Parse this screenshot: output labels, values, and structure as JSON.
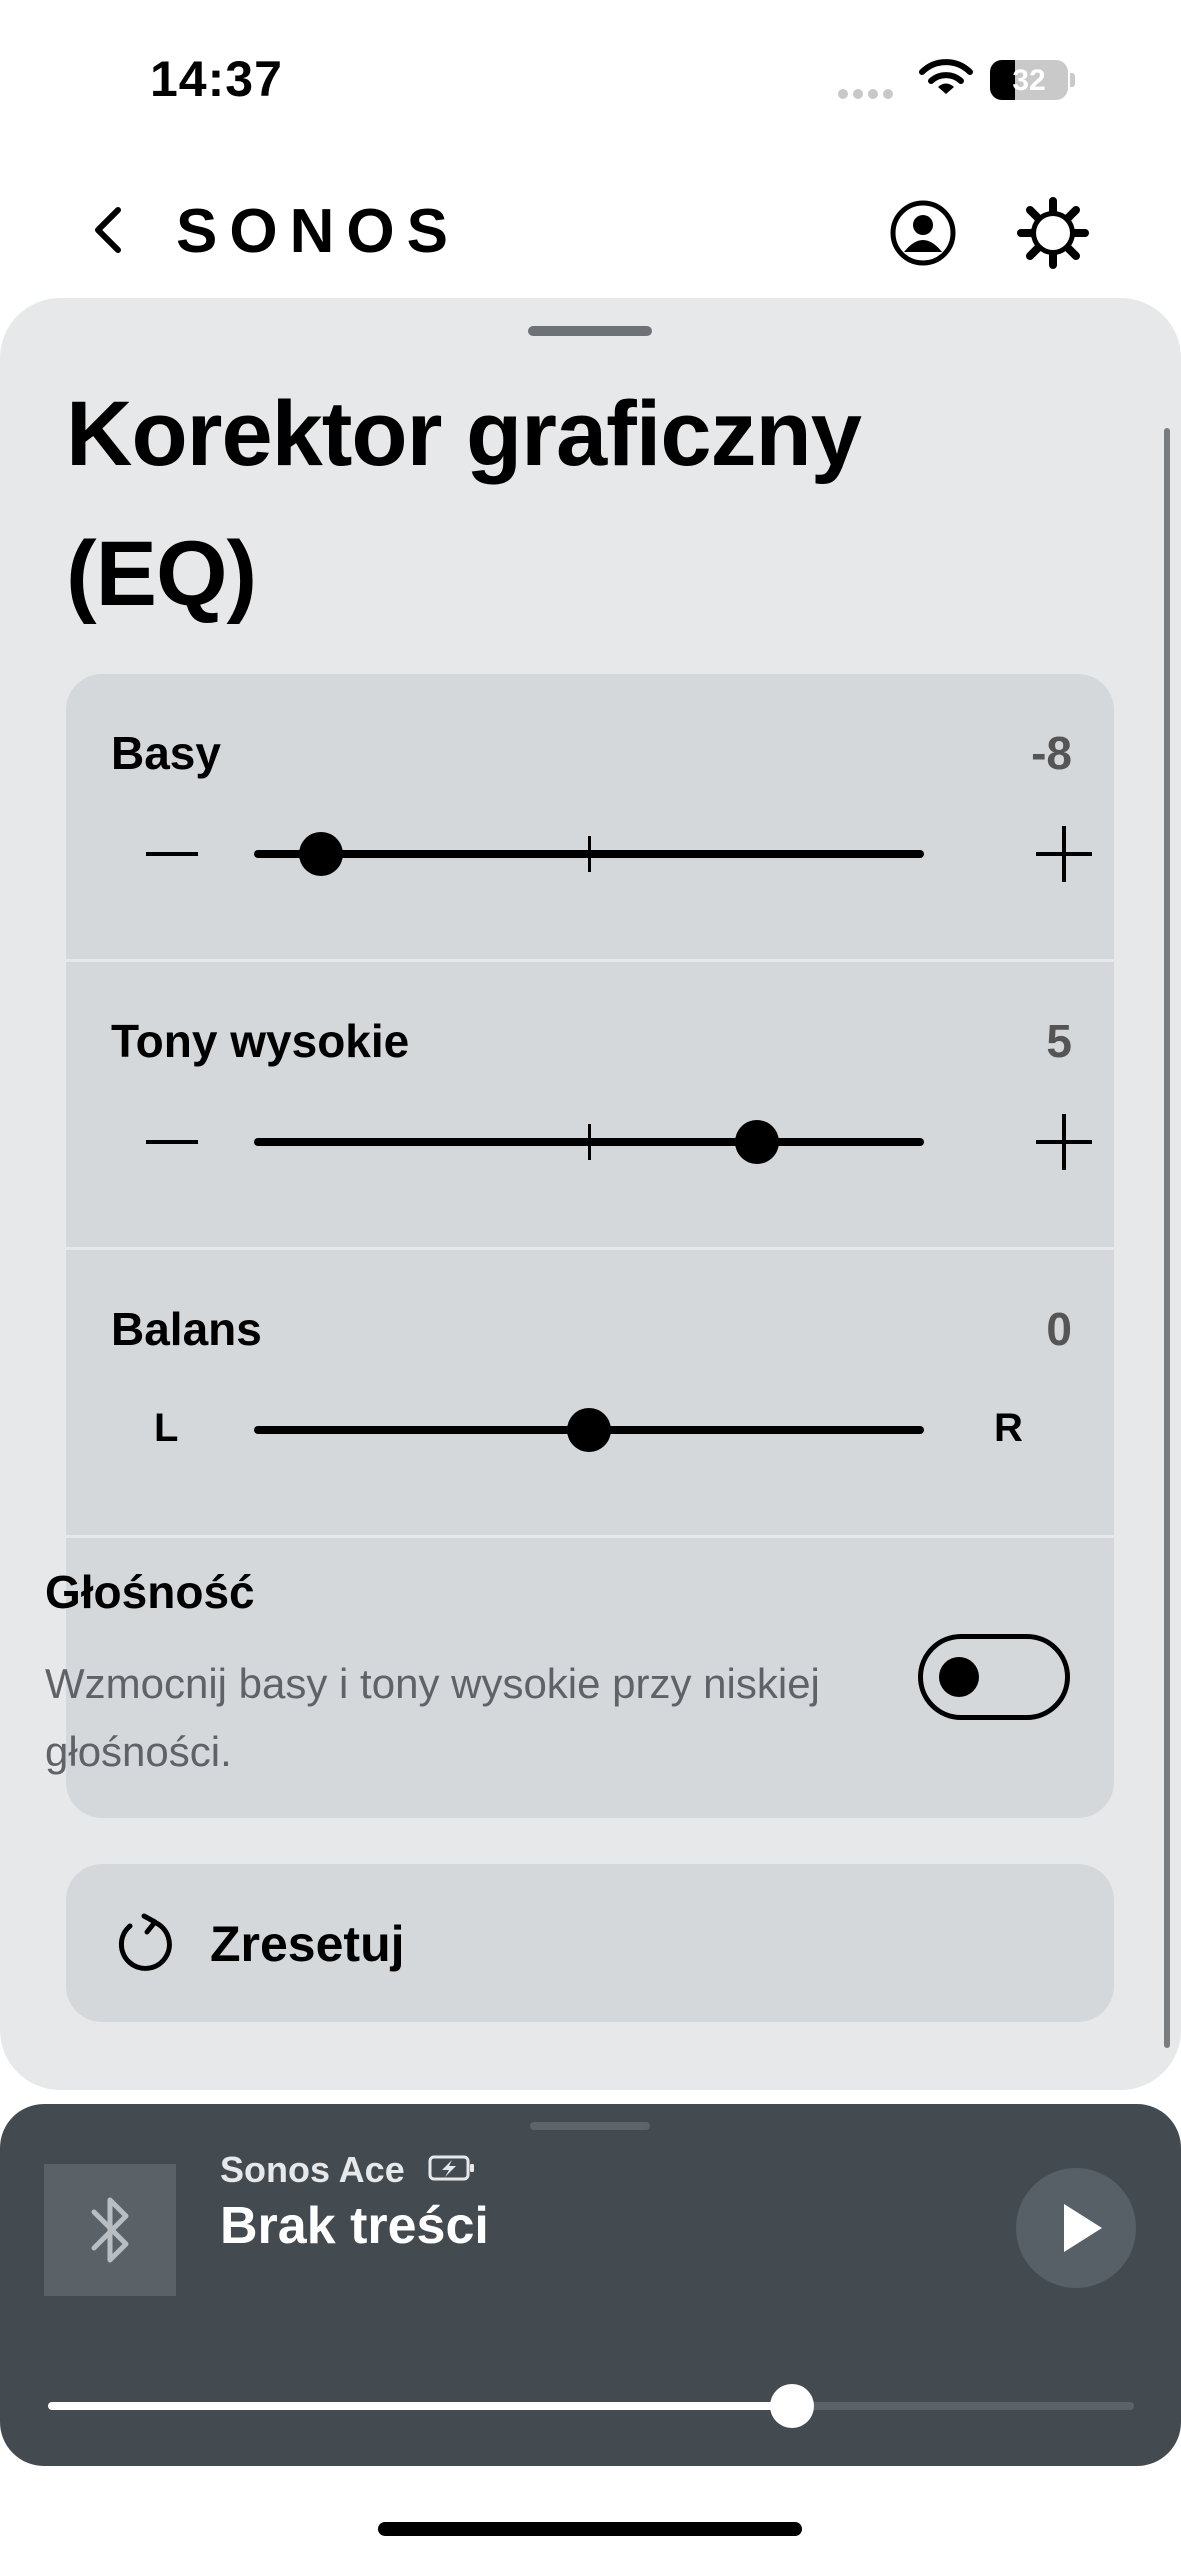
{
  "status_bar": {
    "time": "14:37",
    "battery_percent": "32",
    "battery_level": 0.32
  },
  "nav": {
    "logo": "SONOS",
    "back_icon": "chevron-left-icon",
    "account_icon": "account-icon",
    "settings_icon": "gear-icon"
  },
  "eq": {
    "title": "Korektor graficzny (EQ)",
    "bass": {
      "label": "Basy",
      "value": "-8",
      "numeric": -8,
      "min": -10,
      "max": 10
    },
    "treble": {
      "label": "Tony wysokie",
      "value": "5",
      "numeric": 5,
      "min": -10,
      "max": 10
    },
    "balance": {
      "label": "Balans",
      "value": "0",
      "numeric": 0,
      "min": -10,
      "max": 10,
      "left_label": "L",
      "right_label": "R"
    },
    "loudness": {
      "label": "Głośność",
      "description": "Wzmocnij basy i tony wysokie przy niskiej głośności.",
      "enabled": false
    },
    "reset_label": "Zresetuj"
  },
  "player": {
    "device_name": "Sonos Ace",
    "track_title": "Brak treści",
    "source_icon": "bluetooth-icon",
    "volume_level": 0.685
  },
  "colors": {
    "sheet_bg": "#e6e8ea",
    "card_bg": "#d5d8db",
    "player_bg": "#434b51"
  }
}
